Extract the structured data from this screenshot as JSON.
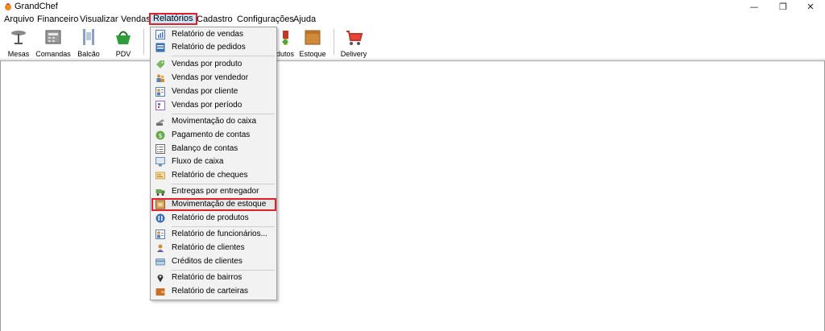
{
  "window": {
    "title": "GrandChef",
    "minimize_glyph": "—",
    "restore_glyph": "❐",
    "close_glyph": "✕"
  },
  "menubar": {
    "items": [
      {
        "label": "Arquivo"
      },
      {
        "label": "Financeiro"
      },
      {
        "label": "Visualizar"
      },
      {
        "label": "Vendas"
      },
      {
        "label": "Relatórios"
      },
      {
        "label": "Cadastro"
      },
      {
        "label": "Configurações"
      },
      {
        "label": "Ajuda"
      }
    ],
    "active": "Relatórios"
  },
  "toolbar": {
    "items": [
      {
        "label": "Mesas",
        "icon": "table-icon"
      },
      {
        "label": "Comandas",
        "icon": "cash-register-icon"
      },
      {
        "label": "Balcão",
        "icon": "counter-icon"
      },
      {
        "label": "PDV",
        "icon": "basket-icon"
      },
      {
        "label": "dutos",
        "icon": "products-icon"
      },
      {
        "label": "Estoque",
        "icon": "box-icon"
      },
      {
        "label": "Delivery",
        "icon": "delivery-cart-icon"
      }
    ]
  },
  "reports_menu": {
    "items": [
      {
        "label": "Relatório de vendas",
        "icon": "bar-chart-icon",
        "color": "#4a76c4"
      },
      {
        "label": "Relatório de pedidos",
        "icon": "list-icon",
        "color": "#3b6fb6"
      },
      {
        "label": "Vendas por produto",
        "icon": "tag-icon",
        "color": "#7bb661"
      },
      {
        "label": "Vendas por vendedor",
        "icon": "people-icon",
        "color": "#c8913a"
      },
      {
        "label": "Vendas por cliente",
        "icon": "person-card-icon",
        "color": "#5a7fb0"
      },
      {
        "label": "Vendas por período",
        "icon": "calendar-icon",
        "color": "#8a6fc0"
      },
      {
        "label": "Movimentação do caixa",
        "icon": "cash-icon",
        "color": "#7a7a7a"
      },
      {
        "label": "Pagamento de contas",
        "icon": "coin-icon",
        "color": "#6aa84f"
      },
      {
        "label": "Balanço de contas",
        "icon": "ledger-icon",
        "color": "#6b6b6b"
      },
      {
        "label": "Fluxo de caixa",
        "icon": "monitor-icon",
        "color": "#6b8fb0"
      },
      {
        "label": "Relatório de cheques",
        "icon": "cheque-icon",
        "color": "#d4a84a"
      },
      {
        "label": "Entregas por entregador",
        "icon": "truck-icon",
        "color": "#6aa84f"
      },
      {
        "label": "Movimentação de estoque",
        "icon": "stock-box-icon",
        "color": "#c8913a"
      },
      {
        "label": "Relatório de produtos",
        "icon": "products-report-icon",
        "color": "#3b6fb6"
      },
      {
        "label": "Relatório de funcionários...",
        "icon": "employee-icon",
        "color": "#5a7fb0"
      },
      {
        "label": "Relatório de clientes",
        "icon": "clients-icon",
        "color": "#c8913a"
      },
      {
        "label": "Créditos de clientes",
        "icon": "credit-card-icon",
        "color": "#6b8fb0"
      },
      {
        "label": "Relatório de bairros",
        "icon": "map-pin-icon",
        "color": "#333333"
      },
      {
        "label": "Relatório de carteiras",
        "icon": "wallet-icon",
        "color": "#c8702a"
      }
    ],
    "highlighted": "Movimentação de estoque"
  },
  "colors": {
    "highlight_border": "#e0202a",
    "active_menu_bg": "#cce4f7"
  }
}
